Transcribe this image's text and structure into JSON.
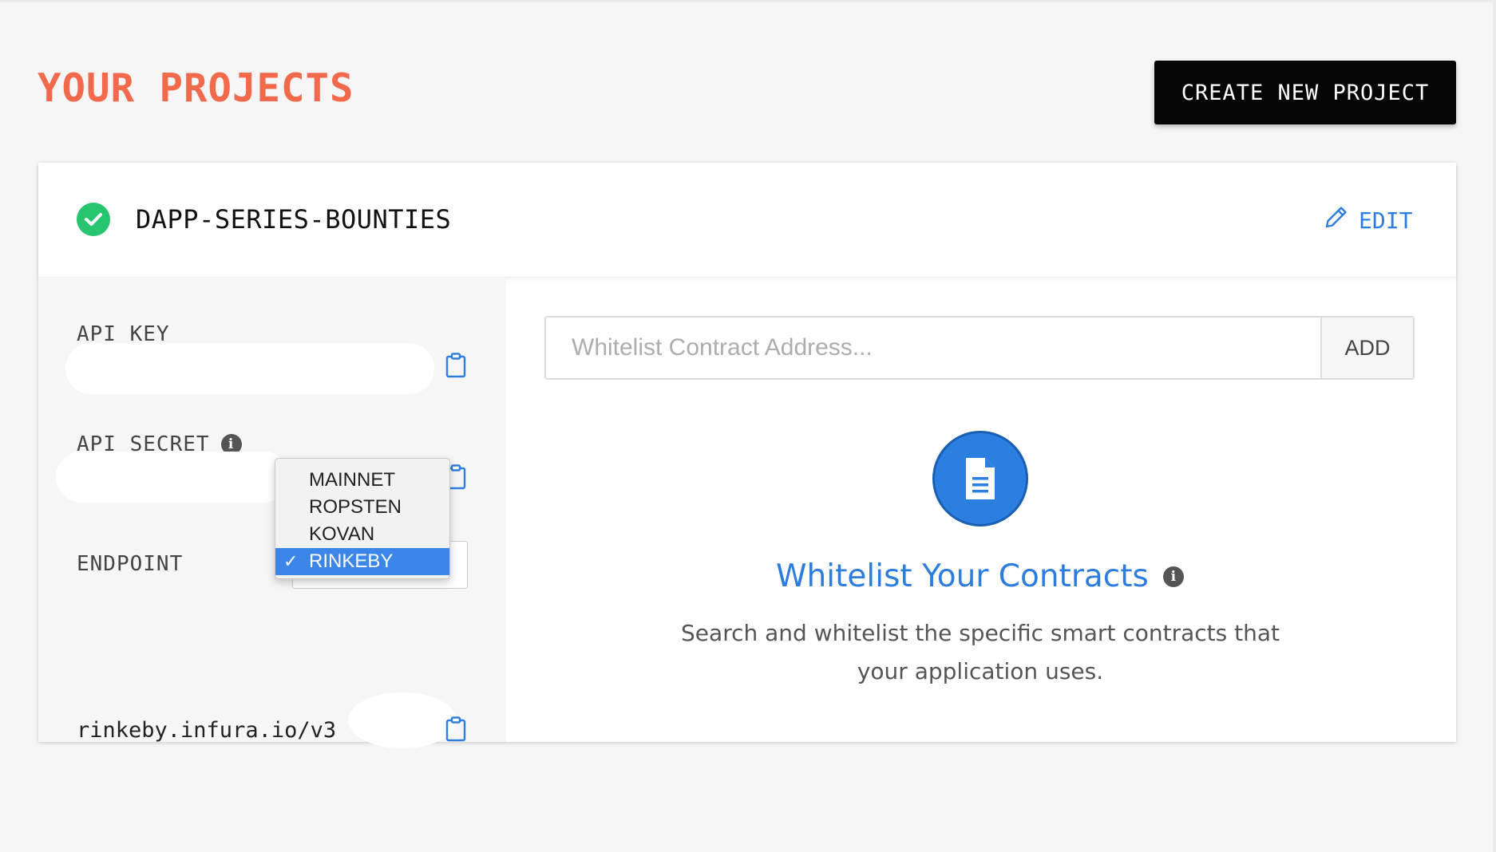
{
  "header": {
    "title": "YOUR PROJECTS",
    "create_button": "CREATE NEW PROJECT"
  },
  "project": {
    "name": "DAPP-SERIES-BOUNTIES",
    "status": "active",
    "edit_label": "EDIT"
  },
  "credentials": {
    "api_key_label": "API KEY",
    "api_secret_label": "API SECRET",
    "endpoint_label": "ENDPOINT",
    "endpoint_url": "rinkeby.infura.io/v3"
  },
  "network_dropdown": {
    "options": [
      "MAINNET",
      "ROPSTEN",
      "KOVAN",
      "RINKEBY"
    ],
    "selected": "RINKEBY"
  },
  "whitelist": {
    "placeholder": "Whitelist Contract Address...",
    "add_button": "ADD",
    "title": "Whitelist Your Contracts",
    "description": "Search and whitelist the specific smart contracts that your application uses."
  },
  "colors": {
    "title": "#f2694b",
    "accent_blue": "#2e7cdc",
    "success_green": "#27c56d",
    "selected_option": "#3b86e8"
  },
  "icons": [
    "check-circle-icon",
    "pencil-icon",
    "clipboard-icon",
    "info-icon",
    "document-icon",
    "checkmark-icon"
  ]
}
